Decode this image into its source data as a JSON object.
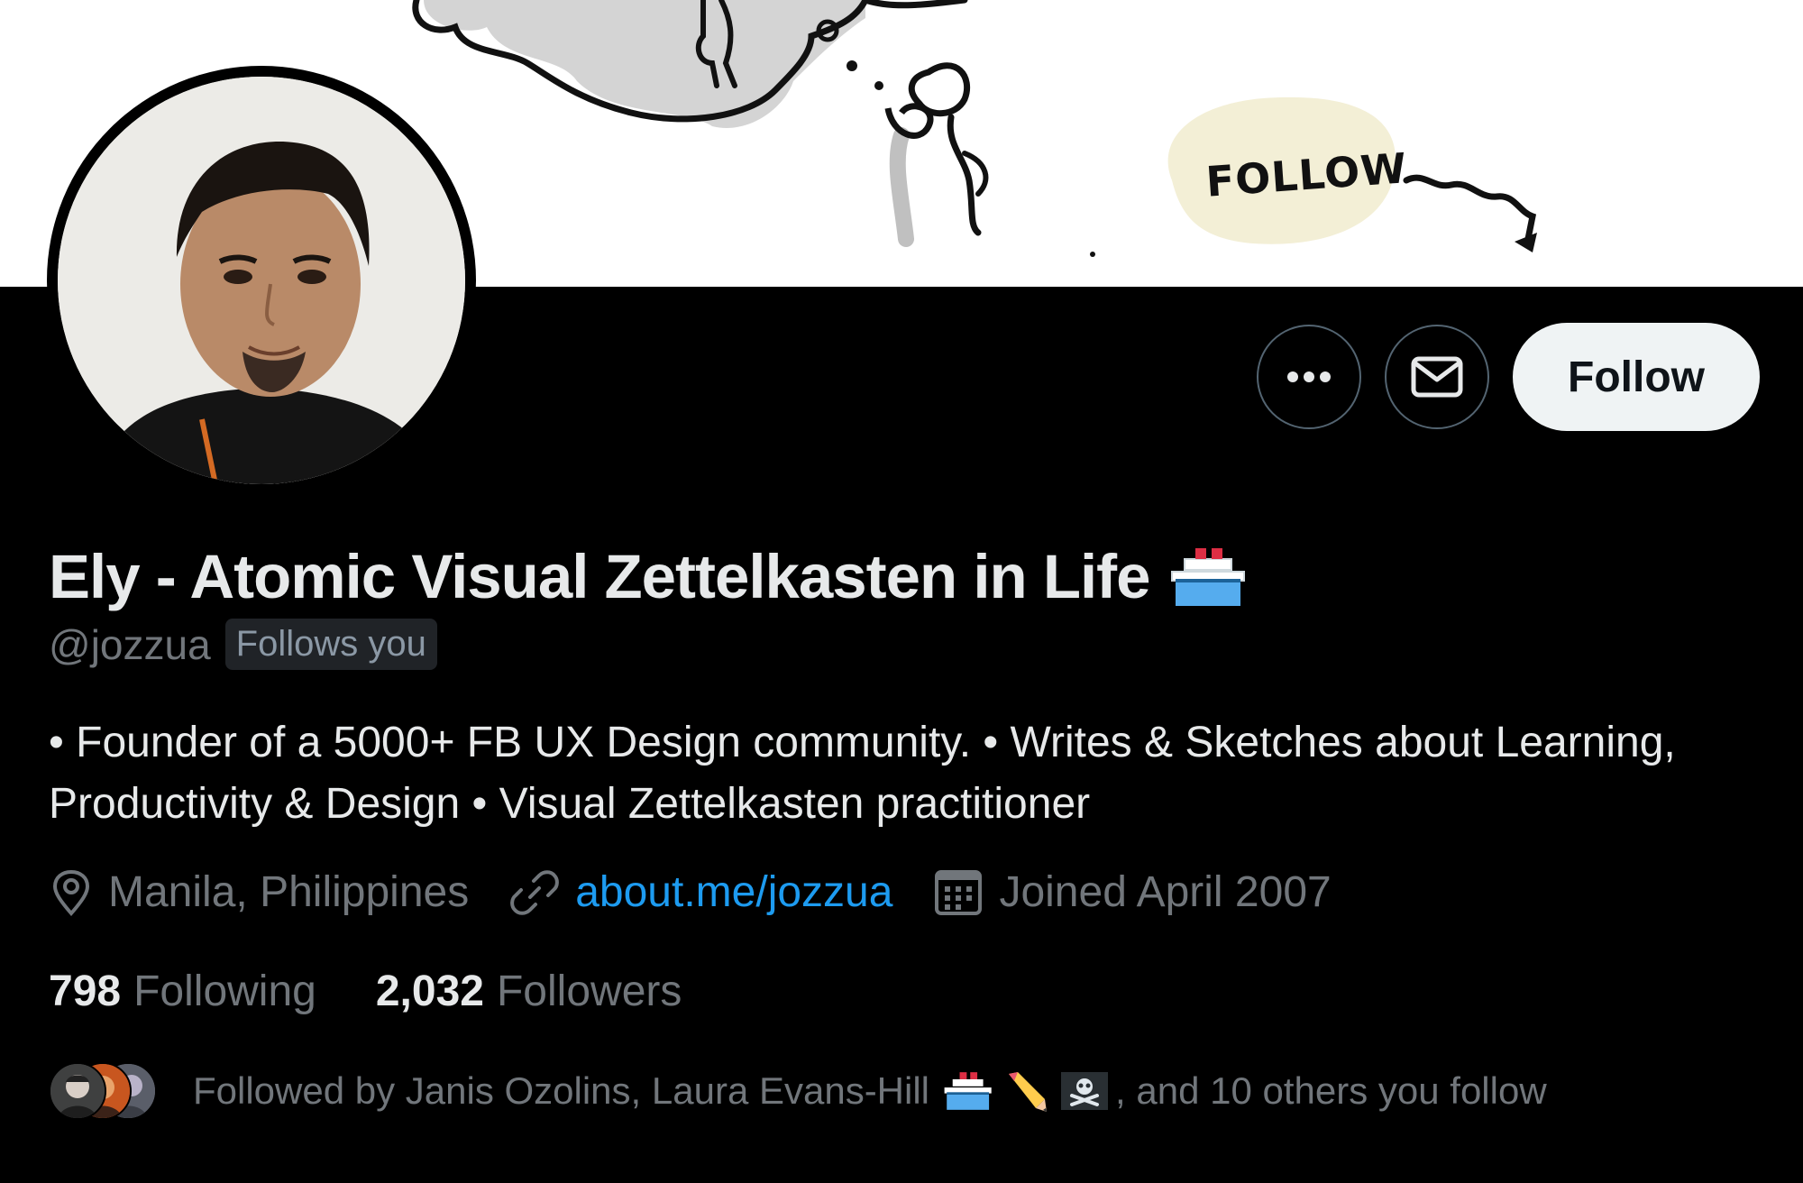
{
  "banner": {
    "sketch_label": "FOLLOW"
  },
  "profile": {
    "display_name": "Ely - Atomic Visual Zettelkasten in Life",
    "name_emoji_icon": "ship-icon",
    "handle": "@jozzua",
    "follows_you": "Follows you",
    "bio": "• Founder of a 5000+ FB UX Design community. • Writes & Sketches about Learning, Productivity & Design • Visual Zettelkasten practitioner",
    "location": "Manila, Philippines",
    "website": "about.me/jozzua",
    "joined": "Joined April 2007"
  },
  "actions": {
    "more_icon": "more-icon",
    "message_icon": "envelope-icon",
    "follow_label": "Follow"
  },
  "stats": {
    "following_count": "798",
    "following_label": "Following",
    "followers_count": "2,032",
    "followers_label": "Followers"
  },
  "followed_by": {
    "prefix": "Followed by Janis Ozolins, Laura Evans-Hill",
    "emoji_icons": [
      "ship-icon",
      "pencil-icon",
      "skull-flag-icon"
    ],
    "suffix": ", and 10 others you follow"
  },
  "colors": {
    "background": "#000000",
    "text_primary": "#e7e9ea",
    "text_secondary": "#71767b",
    "link": "#1d9bf0",
    "follow_button": "#eff3f4"
  }
}
